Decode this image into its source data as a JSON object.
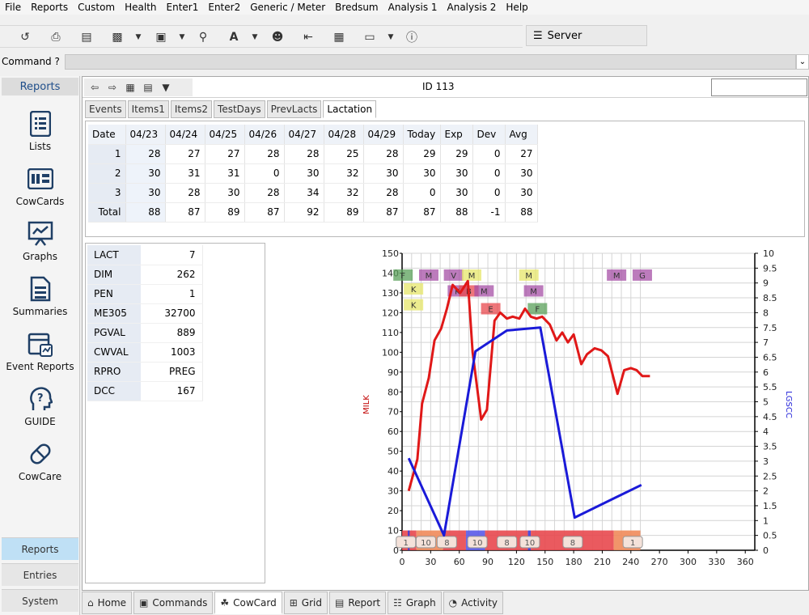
{
  "menu": [
    "File",
    "Reports",
    "Custom",
    "Health",
    "Enter1",
    "Enter2",
    "Generic / Meter",
    "Bredsum",
    "Analysis 1",
    "Analysis 2",
    "Help"
  ],
  "server": {
    "label": "Server"
  },
  "command": {
    "label": "Command ?",
    "value": ""
  },
  "sidebar": {
    "header": "Reports",
    "items": [
      {
        "label": "Lists",
        "icon": "list-icon"
      },
      {
        "label": "CowCards",
        "icon": "card-icon"
      },
      {
        "label": "Graphs",
        "icon": "presentation-chart-icon"
      },
      {
        "label": "Summaries",
        "icon": "document-icon"
      },
      {
        "label": "Event Reports",
        "icon": "calendar-report-icon"
      },
      {
        "label": "GUIDE",
        "icon": "question-head-icon"
      },
      {
        "label": "CowCare",
        "icon": "pill-icon"
      }
    ],
    "tabs": [
      "Reports",
      "Entries",
      "System"
    ]
  },
  "header": {
    "id_text": "ID 113",
    "id_input": ""
  },
  "tabs": [
    "Events",
    "Items1",
    "Items2",
    "TestDays",
    "PrevLacts",
    "Lactation"
  ],
  "active_tab": "Lactation",
  "lactation_table": {
    "columns": [
      "Date",
      "04/23",
      "04/24",
      "04/25",
      "04/26",
      "04/27",
      "04/28",
      "04/29",
      "Today",
      "Exp",
      "Dev",
      "Avg"
    ],
    "rows": [
      [
        "1",
        "28",
        "27",
        "27",
        "28",
        "28",
        "25",
        "28",
        "29",
        "29",
        "0",
        "27"
      ],
      [
        "2",
        "30",
        "31",
        "31",
        "0",
        "30",
        "32",
        "30",
        "30",
        "30",
        "0",
        "30"
      ],
      [
        "3",
        "30",
        "28",
        "30",
        "28",
        "34",
        "32",
        "28",
        "0",
        "30",
        "0",
        "30"
      ],
      [
        "Total",
        "88",
        "87",
        "89",
        "87",
        "92",
        "89",
        "87",
        "87",
        "88",
        "-1",
        "88"
      ]
    ]
  },
  "info": [
    {
      "key": "LACT",
      "value": "7"
    },
    {
      "key": "DIM",
      "value": "262"
    },
    {
      "key": "PEN",
      "value": "1"
    },
    {
      "key": "ME305",
      "value": "32700"
    },
    {
      "key": "PGVAL",
      "value": "889"
    },
    {
      "key": "CWVAL",
      "value": "1003"
    },
    {
      "key": "RPRO",
      "value": "PREG"
    },
    {
      "key": "DCC",
      "value": "167"
    }
  ],
  "chart_data": {
    "type": "line",
    "ylabel": "MILK",
    "y2label": "LGSCC",
    "xlim": [
      0,
      370
    ],
    "ylim": [
      0,
      150
    ],
    "y2lim": [
      0,
      10
    ],
    "xticks": [
      0,
      30,
      60,
      90,
      120,
      150,
      180,
      210,
      240,
      270,
      300,
      330,
      360
    ],
    "yticks": [
      0,
      10,
      20,
      30,
      40,
      50,
      60,
      70,
      80,
      90,
      100,
      110,
      120,
      130,
      140,
      150
    ],
    "y2ticks": [
      "0",
      "0.5",
      "1",
      "1.5",
      "2",
      "2.5",
      "3",
      "3.5",
      "4",
      "4.5",
      "5",
      "5.5",
      "6",
      "6.5",
      "7",
      "7.5",
      "8",
      "8.5",
      "9",
      "9.5",
      "10"
    ],
    "grid": true,
    "series": [
      {
        "color": "#e01818",
        "axis": "left",
        "points": [
          [
            7,
            30
          ],
          [
            16,
            46
          ],
          [
            21,
            74
          ],
          [
            28,
            87
          ],
          [
            34,
            106
          ],
          [
            41,
            112
          ],
          [
            47,
            122
          ],
          [
            53,
            134
          ],
          [
            61,
            130
          ],
          [
            69,
            136
          ],
          [
            74,
            100
          ],
          [
            83,
            66
          ],
          [
            89,
            71
          ],
          [
            97,
            116
          ],
          [
            103,
            120
          ],
          [
            110,
            117
          ],
          [
            116,
            118
          ],
          [
            123,
            117
          ],
          [
            129,
            122
          ],
          [
            135,
            118
          ],
          [
            141,
            117
          ],
          [
            147,
            118
          ],
          [
            155,
            114
          ],
          [
            162,
            106
          ],
          [
            168,
            110
          ],
          [
            174,
            105
          ],
          [
            180,
            109
          ],
          [
            188,
            94
          ],
          [
            194,
            99
          ],
          [
            202,
            102
          ],
          [
            209,
            101
          ],
          [
            216,
            98
          ],
          [
            226,
            79
          ],
          [
            233,
            91
          ],
          [
            240,
            92
          ],
          [
            246,
            91
          ],
          [
            252,
            88
          ],
          [
            260,
            88
          ]
        ]
      },
      {
        "color": "#1a1ad8",
        "axis": "right",
        "points": [
          [
            7,
            3.1
          ],
          [
            44,
            0.5
          ],
          [
            77,
            6.7
          ],
          [
            110,
            7.4
          ],
          [
            145,
            7.5
          ],
          [
            181,
            1.1
          ],
          [
            251,
            2.2
          ]
        ]
      }
    ],
    "event_markers": [
      {
        "label": "F",
        "x": 1,
        "y": 139,
        "color": "#5aa05a"
      },
      {
        "label": "K",
        "x": 12,
        "y": 132,
        "color": "#e6e66a"
      },
      {
        "label": "K",
        "x": 12,
        "y": 124,
        "color": "#e6e66a"
      },
      {
        "label": "M",
        "x": 28,
        "y": 139,
        "color": "#a64fa6"
      },
      {
        "label": "V",
        "x": 54,
        "y": 139,
        "color": "#a64fa6"
      },
      {
        "label": "M",
        "x": 73,
        "y": 139,
        "color": "#e6e66a"
      },
      {
        "label": "K",
        "x": 58,
        "y": 131,
        "color": "#a64fa6"
      },
      {
        "label": "B",
        "x": 70,
        "y": 131,
        "color": "#e8484e"
      },
      {
        "label": "M",
        "x": 86,
        "y": 131,
        "color": "#a64fa6"
      },
      {
        "label": "E",
        "x": 93,
        "y": 122,
        "color": "#e8484e"
      },
      {
        "label": "M",
        "x": 133,
        "y": 139,
        "color": "#e6e66a"
      },
      {
        "label": "M",
        "x": 138,
        "y": 131,
        "color": "#a64fa6"
      },
      {
        "label": "F",
        "x": 142,
        "y": 122,
        "color": "#5aa05a"
      },
      {
        "label": "M",
        "x": 225,
        "y": 139,
        "color": "#a64fa6"
      },
      {
        "label": "G",
        "x": 252,
        "y": 139,
        "color": "#a64fa6"
      }
    ],
    "bottom_bands": [
      {
        "x0": 0,
        "x1": 15,
        "color": "#e8484e"
      },
      {
        "x0": 6,
        "x1": 8,
        "color": "#3a3ad8"
      },
      {
        "x0": 15,
        "x1": 43,
        "color": "#f08a5a"
      },
      {
        "x0": 43,
        "x1": 67,
        "color": "#e8484e"
      },
      {
        "x0": 67,
        "x1": 87,
        "color": "#5a5ae8"
      },
      {
        "x0": 87,
        "x1": 132,
        "color": "#e8484e"
      },
      {
        "x0": 132,
        "x1": 135,
        "color": "#3a3ad8"
      },
      {
        "x0": 135,
        "x1": 222,
        "color": "#e8484e"
      },
      {
        "x0": 222,
        "x1": 250,
        "color": "#f08a5a"
      }
    ],
    "bottom_labels": [
      {
        "label": "1",
        "x": 4
      },
      {
        "label": "10",
        "x": 25
      },
      {
        "label": "8",
        "x": 47
      },
      {
        "label": "10",
        "x": 79
      },
      {
        "label": "8",
        "x": 110
      },
      {
        "label": "10",
        "x": 134
      },
      {
        "label": "8",
        "x": 179
      },
      {
        "label": "1",
        "x": 242
      }
    ]
  },
  "bottom_tabs": [
    {
      "label": "Home",
      "icon": "home-icon"
    },
    {
      "label": "Commands",
      "icon": "commands-icon"
    },
    {
      "label": "CowCard",
      "icon": "cow-icon"
    },
    {
      "label": "Grid",
      "icon": "grid-icon"
    },
    {
      "label": "Report",
      "icon": "report-icon"
    },
    {
      "label": "Graph",
      "icon": "graph-icon"
    },
    {
      "label": "Activity",
      "icon": "gauge-icon"
    }
  ],
  "active_bottom_tab": "CowCard"
}
